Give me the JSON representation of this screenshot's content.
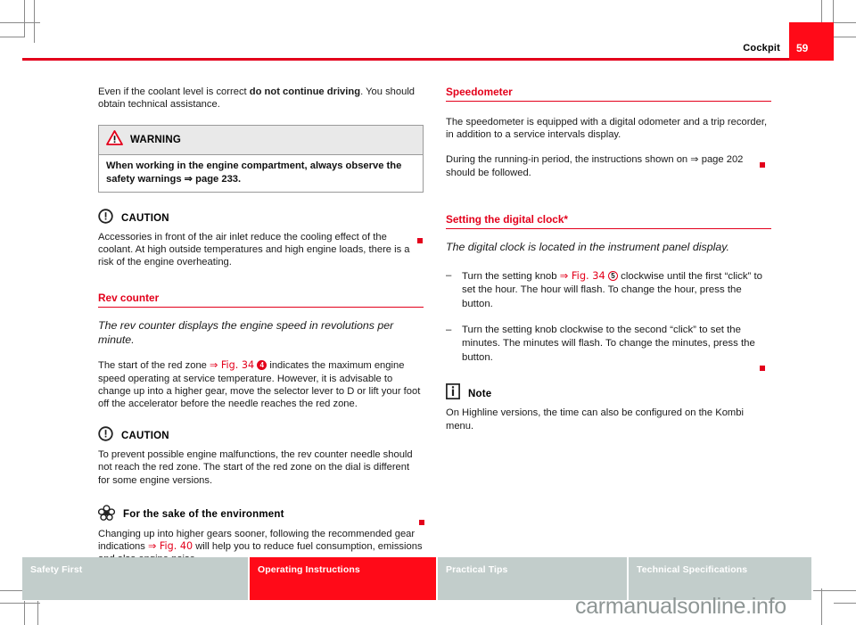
{
  "header": {
    "title": "Cockpit",
    "page_number": "59"
  },
  "left_column": {
    "intro": {
      "before_bold": "Even if the coolant level is correct ",
      "bold": "do not continue driving",
      "after_bold": ". You should obtain technical assistance."
    },
    "warning": {
      "icon": "warning-triangle-icon",
      "label": "WARNING",
      "body": "When working in the engine compartment, always observe the safety warnings ⇒ page 233."
    },
    "caution1": {
      "icon": "caution-exclamation-icon",
      "label": "CAUTION",
      "body": "Accessories in front of the air inlet reduce the cooling effect of the coolant. At high outside temperatures and high engine loads, there is a risk of the engine overheating."
    },
    "rev_counter": {
      "heading": "Rev counter",
      "lead_in": "The rev counter displays the engine speed in revolutions per minute.",
      "body_part1": "The start of the red zone ",
      "body_ref": "⇒ Fig. 34",
      "body_circle": "4",
      "body_part2": " indicates the maximum engine speed operating at service temperature. However, it is advisable to change up into a higher gear, move the selector lever to D or lift your foot off the accelerator before the needle reaches the red zone."
    },
    "caution2": {
      "icon": "caution-exclamation-icon",
      "label": "CAUTION",
      "body": "To prevent possible engine malfunctions, the rev counter needle should not reach the red zone. The start of the red zone on the dial is different for some engine versions."
    },
    "environment": {
      "icon": "flower-environment-icon",
      "label": "For the sake of the environment",
      "body_part1": "Changing up into higher gears sooner, following the recommended gear indications ",
      "body_ref": "⇒ Fig. 40",
      "body_part2": " will help you to reduce fuel consumption, emissions and also engine noise."
    }
  },
  "right_column": {
    "speedometer": {
      "heading": "Speedometer",
      "para1": "The speedometer is equipped with a digital odometer and a trip recorder, in addition to a service intervals display.",
      "para2": "During the running-in period, the instructions shown on ⇒ page 202 should be followed."
    },
    "clock": {
      "heading": "Setting the digital clock*",
      "lead_in": "The digital clock is located in the instrument panel display.",
      "steps": [
        {
          "dash": "–",
          "part1": "Turn the setting knob ",
          "ref": "⇒ Fig. 34",
          "circle": "5",
          "part2": " clockwise until the first “click” to set the hour. The hour will flash. To change the hour, press the button."
        },
        {
          "dash": "–",
          "part1": "Turn the setting knob clockwise to the second “click” to set the minutes. The minutes will flash. To change the minutes, press the button.",
          "ref": "",
          "circle": "",
          "part2": ""
        }
      ],
      "note": {
        "icon": "info-note-icon",
        "label": "Note",
        "body": "On Highline versions, the time can also be configured on the Kombi menu."
      }
    }
  },
  "footer": {
    "tabs": [
      {
        "label": "Safety First",
        "active": false
      },
      {
        "label": "Operating Instructions",
        "active": true
      },
      {
        "label": "Practical Tips",
        "active": false
      },
      {
        "label": "Technical Specifications",
        "active": false
      }
    ]
  },
  "watermark": {
    "text": "carmanualsonline.info"
  }
}
